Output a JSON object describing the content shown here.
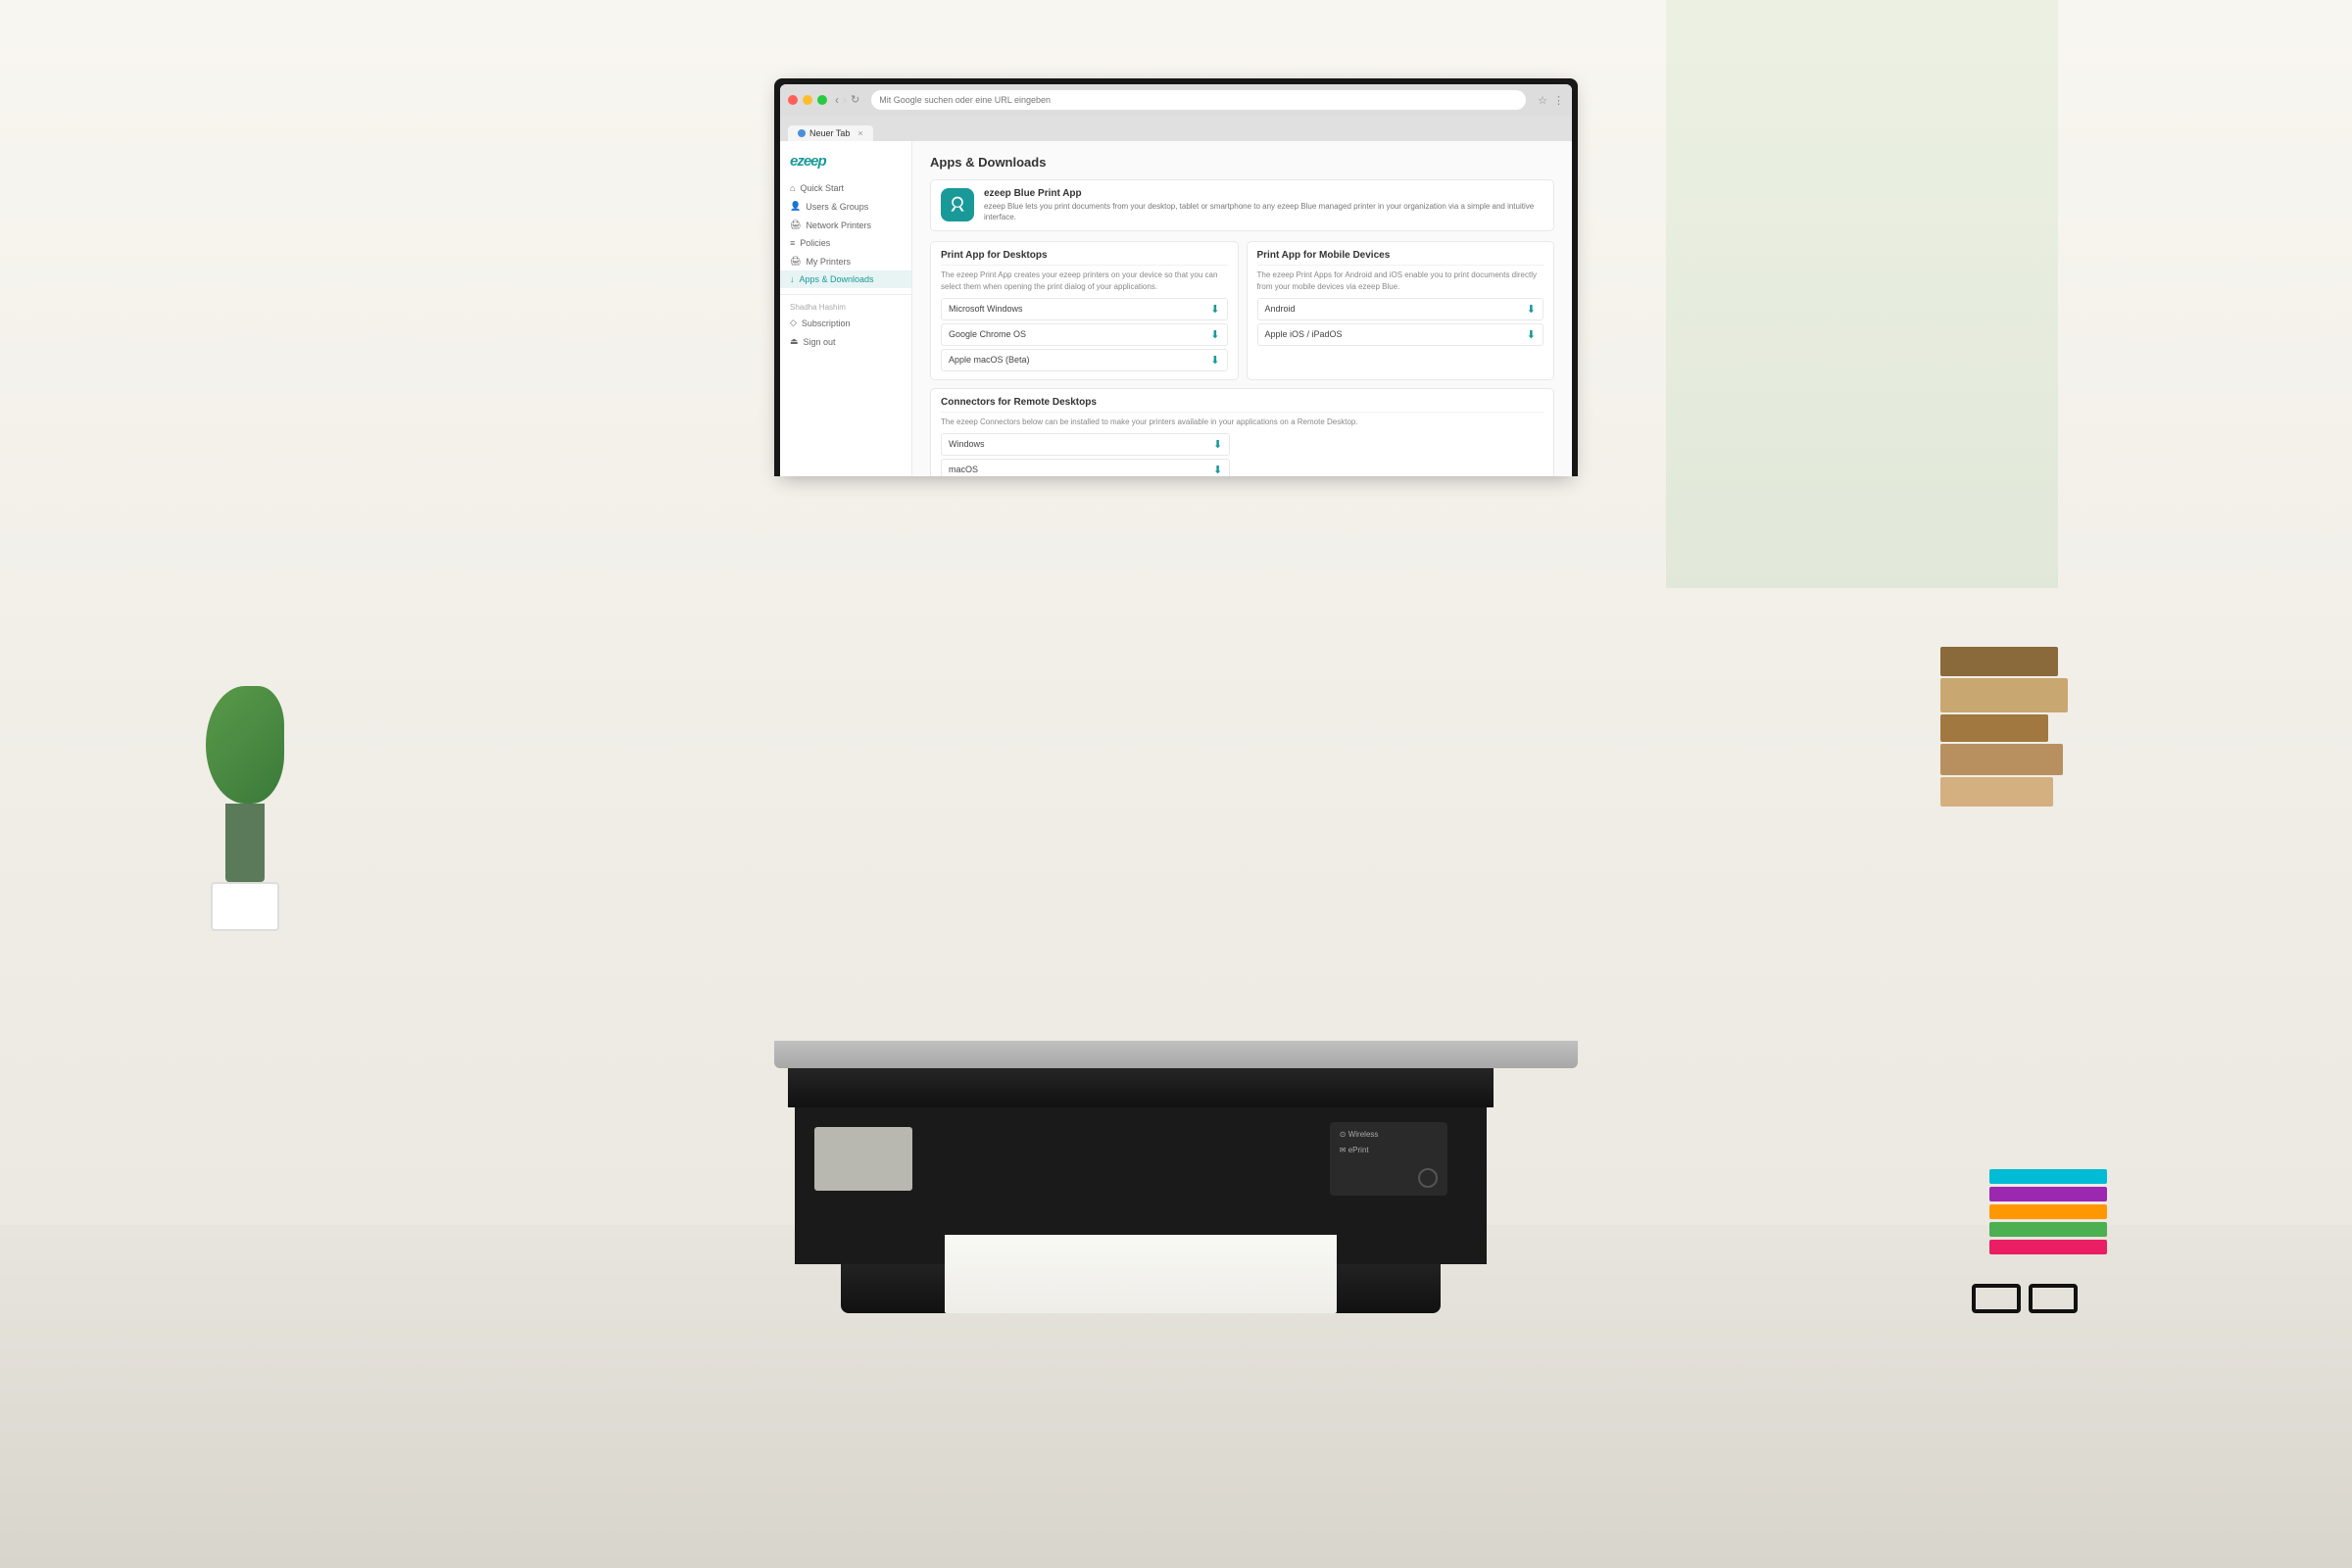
{
  "scene": {
    "background_color": "#e8e5de"
  },
  "browser": {
    "tab_title": "Neuer Tab",
    "address_bar_placeholder": "Mit Google suchen oder eine URL eingeben",
    "address_bar_value": "Mit Google suchen oder eine URL eingeben"
  },
  "sidebar": {
    "logo": "ezeep",
    "items": [
      {
        "id": "quick-start",
        "label": "Quick Start",
        "icon": "⊙"
      },
      {
        "id": "users-groups",
        "label": "Users & Groups",
        "icon": "👥"
      },
      {
        "id": "network-printers",
        "label": "Network Printers",
        "icon": "🖨"
      },
      {
        "id": "policies",
        "label": "Policies",
        "icon": "☰"
      },
      {
        "id": "my-printers",
        "label": "My Printers",
        "icon": "🖨"
      },
      {
        "id": "apps-downloads",
        "label": "Apps & Downloads",
        "icon": "⬇",
        "active": true
      }
    ],
    "section_label": "Shadha Hashim",
    "bottom_items": [
      {
        "id": "subscription",
        "label": "Subscription",
        "icon": "◇"
      },
      {
        "id": "sign-out",
        "label": "Sign out",
        "icon": "⏏"
      }
    ]
  },
  "main": {
    "page_title": "Apps & Downloads",
    "app_banner": {
      "name": "ezeep Blue Print App",
      "description": "ezeep Blue lets you print documents from your desktop, tablet or smartphone to any ezeep Blue managed printer in your organization via a simple and intuitive interface."
    },
    "sections": [
      {
        "id": "desktop",
        "title": "Print App for Desktops",
        "description": "The ezeep Print App creates your ezeep printers on your device so that you can select them when opening the print dialog of your applications.",
        "items": [
          {
            "label": "Microsoft Windows"
          },
          {
            "label": "Google Chrome OS"
          },
          {
            "label": "Apple macOS (Beta)"
          }
        ]
      },
      {
        "id": "mobile",
        "title": "Print App for Mobile Devices",
        "description": "The ezeep Print Apps for Android and iOS enable you to print documents directly from your mobile devices via ezeep Blue.",
        "items": [
          {
            "label": "Android"
          },
          {
            "label": "Apple iOS / iPadOS"
          }
        ]
      },
      {
        "id": "connectors",
        "title": "Connectors for Remote Desktops",
        "description": "The ezeep Connectors below can be installed to make your printers available in your applications on a Remote Desktop.",
        "full_width": true,
        "items": [
          {
            "label": "Windows"
          },
          {
            "label": "macOS"
          }
        ]
      }
    ]
  }
}
